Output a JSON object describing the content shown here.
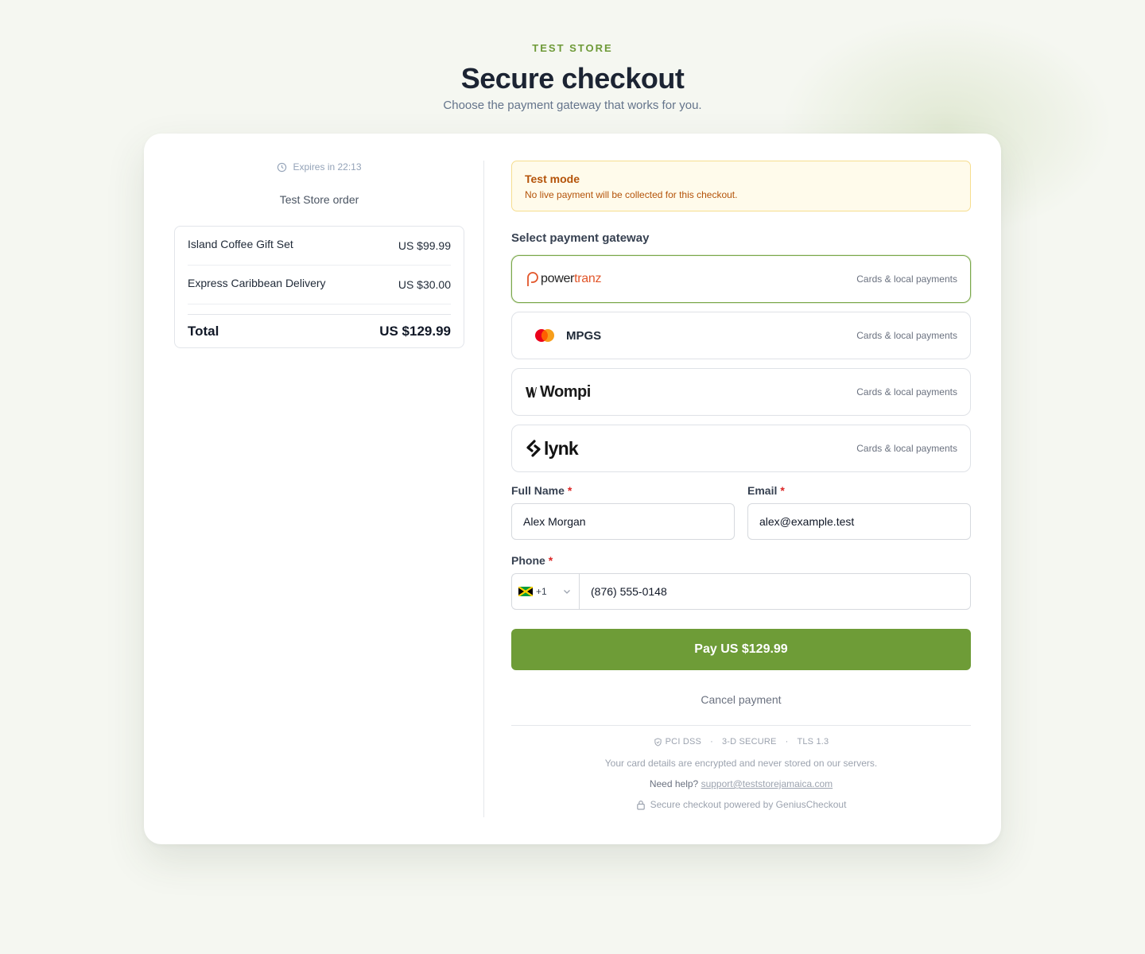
{
  "header": {
    "store_name": "TEST STORE",
    "title": "Secure checkout",
    "subtitle": "Choose the payment gateway that works for you."
  },
  "order": {
    "expires_text": "Expires in 22:13",
    "title": "Test Store order",
    "items": [
      {
        "name": "Island Coffee Gift Set",
        "price": "US $99.99"
      },
      {
        "name": "Express Caribbean Delivery",
        "price": "US $30.00"
      }
    ],
    "total_label": "Total",
    "total_value": "US $129.99"
  },
  "test_mode": {
    "title": "Test mode",
    "message": "No live payment will be collected for this checkout."
  },
  "gateway_section": {
    "label": "Select payment gateway",
    "gateways": [
      {
        "name": "powertranz",
        "logo_part1": "power",
        "logo_part2": "tranz",
        "desc": "Cards & local payments",
        "selected": true
      },
      {
        "name": "MPGS",
        "desc": "Cards & local payments",
        "selected": false
      },
      {
        "name": "Wompi",
        "desc": "Cards & local payments",
        "selected": false
      },
      {
        "name": "lynk",
        "desc": "Cards & local payments",
        "selected": false
      }
    ]
  },
  "form": {
    "full_name_label": "Full Name",
    "full_name_value": "Alex Morgan",
    "email_label": "Email",
    "email_value": "alex@example.test",
    "phone_label": "Phone",
    "country_code": "+1",
    "phone_value": "(876) 555-0148",
    "required_mark": "*"
  },
  "actions": {
    "pay_label": "Pay US $129.99",
    "cancel_label": "Cancel payment"
  },
  "footer": {
    "badges": [
      "PCI DSS",
      "3-D SECURE",
      "TLS 1.3"
    ],
    "separator": "·",
    "encryption_note": "Your card details are encrypted and never stored on our servers.",
    "help_prefix": "Need help?",
    "help_email": "support@teststorejamaica.com",
    "powered_by": "Secure checkout powered by GeniusCheckout"
  },
  "colors": {
    "brand_green": "#6e9c37",
    "warning_text": "#b45309",
    "required_red": "#dc2626"
  },
  "icons": [
    "clock-icon",
    "powertranz-logo-icon",
    "mastercard-icon",
    "wompi-logo-icon",
    "lynk-logo-icon",
    "jamaica-flag-icon",
    "chevron-down-icon",
    "shield-icon",
    "lock-icon"
  ]
}
